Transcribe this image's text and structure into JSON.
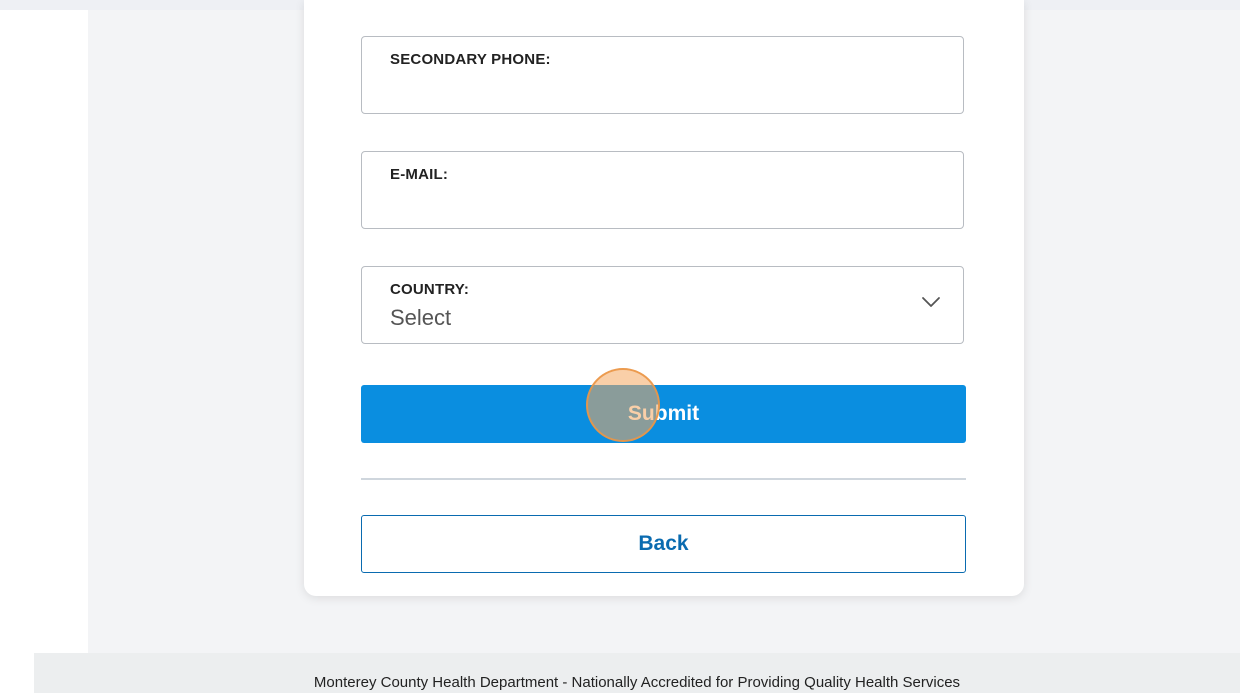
{
  "form": {
    "secondary_phone": {
      "label": "SECONDARY PHONE:",
      "value": ""
    },
    "email": {
      "label": "E-MAIL:",
      "value": ""
    },
    "country": {
      "label": "COUNTRY:",
      "value": "Select",
      "icon": "chevron-down-icon"
    },
    "submit_label": "Submit",
    "back_label": "Back"
  },
  "footer": {
    "text": "Monterey County Health Department - Nationally Accredited for Providing Quality Health Services"
  },
  "colors": {
    "primary": "#0a8ee0",
    "back_border": "#0a6bb0",
    "page_bg": "#f3f4f6"
  }
}
